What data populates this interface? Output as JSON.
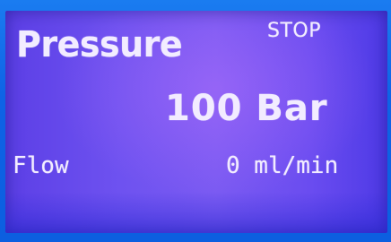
{
  "display": {
    "pressure_label": "Pressure",
    "status": "STOP",
    "pressure_value": "100 Bar",
    "flow_label": "Flow",
    "flow_value": "0 ml/min"
  },
  "colors": {
    "bezel": "#0f66e8",
    "screen": "#6e52f0",
    "text": "#f2ecff"
  }
}
